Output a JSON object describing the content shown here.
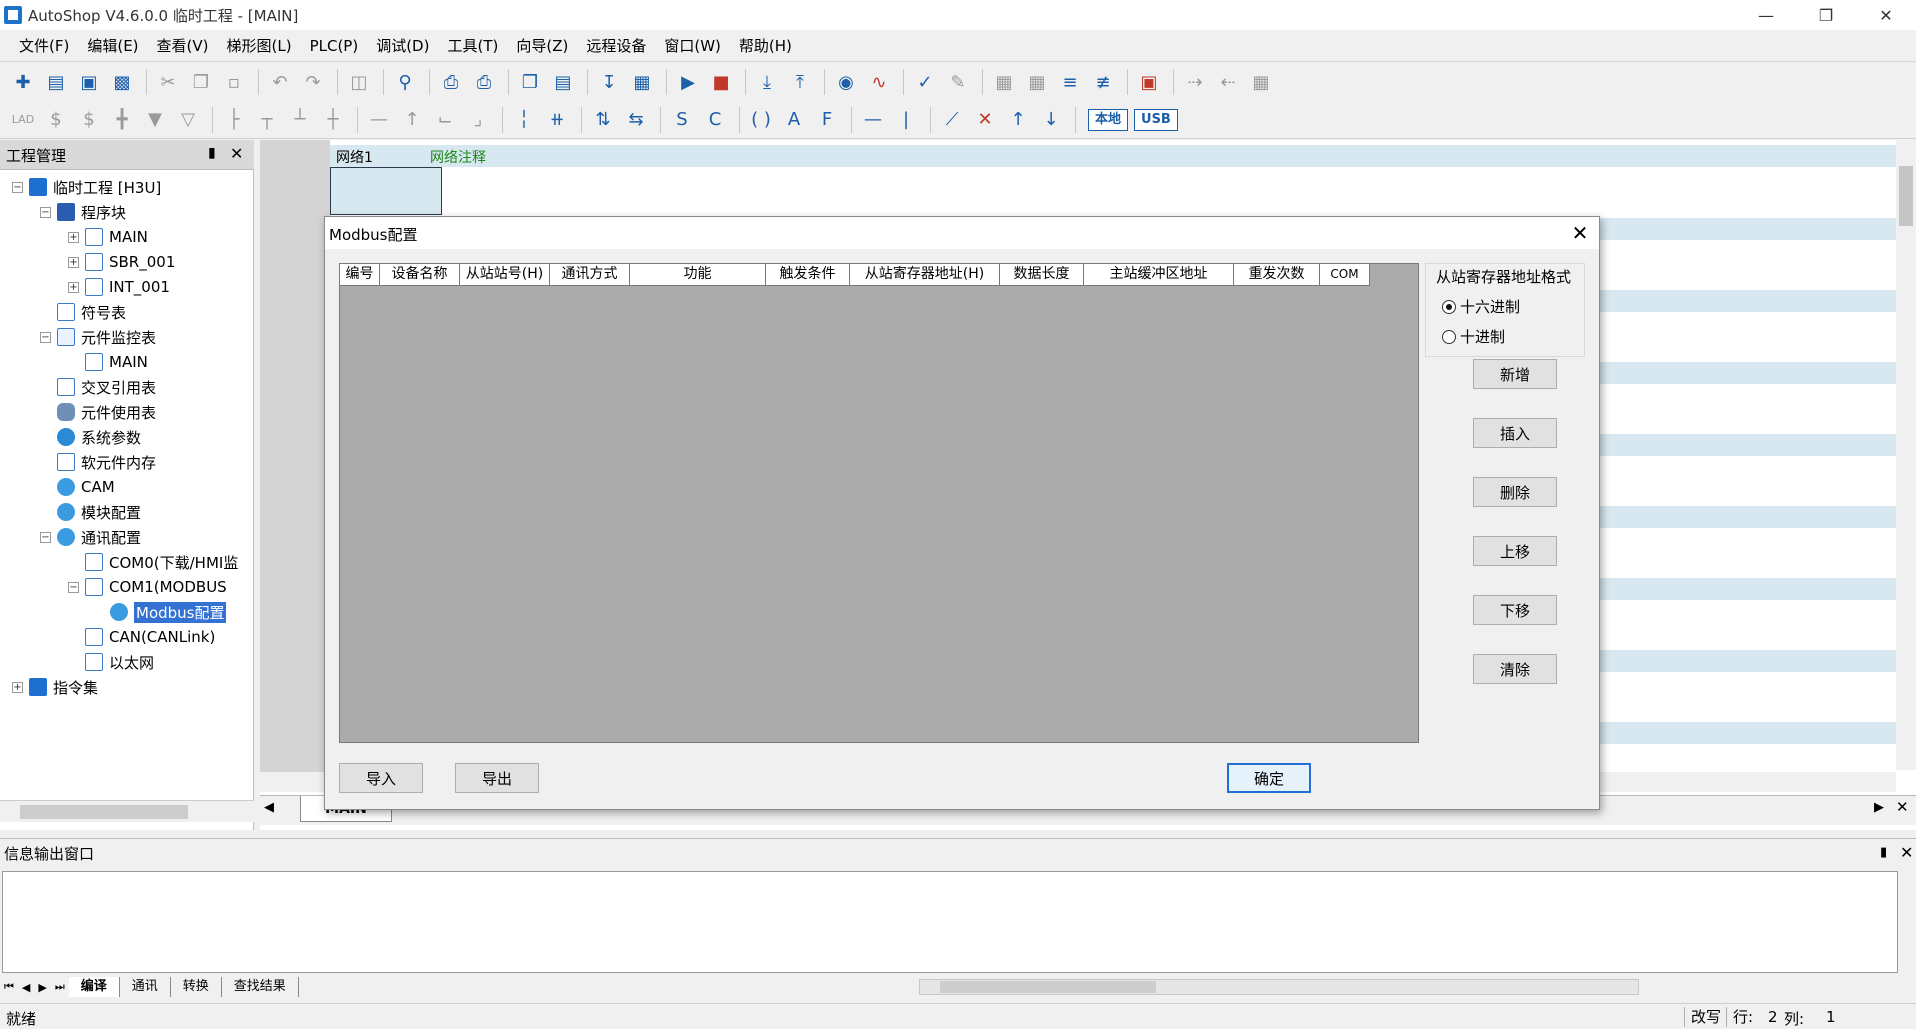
{
  "window": {
    "title": "AutoShop V4.6.0.0  临时工程 - [MAIN]"
  },
  "menu": [
    "文件(F)",
    "编辑(E)",
    "查看(V)",
    "梯形图(L)",
    "PLC(P)",
    "调试(D)",
    "工具(T)",
    "向导(Z)",
    "远程设备",
    "窗口(W)",
    "帮助(H)"
  ],
  "toolbar2": {
    "local_label": "本地",
    "usb_label": "USB",
    "lad_label": "LAD"
  },
  "project": {
    "title": "工程管理",
    "tree": [
      {
        "label": "临时工程 [H3U]"
      },
      {
        "label": "程序块"
      },
      {
        "label": "MAIN"
      },
      {
        "label": "SBR_001"
      },
      {
        "label": "INT_001"
      },
      {
        "label": "符号表"
      },
      {
        "label": "元件监控表"
      },
      {
        "label": "MAIN"
      },
      {
        "label": "交叉引用表"
      },
      {
        "label": "元件使用表"
      },
      {
        "label": "系统参数"
      },
      {
        "label": "软元件内存"
      },
      {
        "label": "CAM"
      },
      {
        "label": "模块配置"
      },
      {
        "label": "通讯配置"
      },
      {
        "label": "COM0(下载/HMI监"
      },
      {
        "label": "COM1(MODBUS"
      },
      {
        "label": "Modbus配置"
      },
      {
        "label": "CAN(CANLink)"
      },
      {
        "label": "以太网"
      },
      {
        "label": "指令集"
      }
    ]
  },
  "editor": {
    "network_label": "网络1",
    "network_comment": "网络注释",
    "tab_main": "MAIN"
  },
  "dialog": {
    "title": "Modbus配置",
    "columns": [
      "编号",
      "设备名称",
      "从站站号(H)",
      "通讯方式",
      "功能",
      "触发条件",
      "从站寄存器地址(H)",
      "数据长度",
      "主站缓冲区地址",
      "重发次数",
      "COM"
    ],
    "format_group": {
      "title": "从站寄存器地址格式",
      "options": [
        "十六进制",
        "十进制"
      ],
      "selected": "十六进制"
    },
    "buttons": {
      "add": "新增",
      "insert": "插入",
      "delete": "删除",
      "up": "上移",
      "down": "下移",
      "clear": "清除",
      "import": "导入",
      "export": "导出",
      "ok": "确定"
    }
  },
  "output": {
    "title": "信息输出窗口",
    "tabs": [
      "编译",
      "通讯",
      "转换",
      "查找结果"
    ]
  },
  "status": {
    "text": "就绪",
    "mode": "改写",
    "row_label": "行:",
    "row_value": "2",
    "col_label": "列:",
    "col_value": "1"
  }
}
